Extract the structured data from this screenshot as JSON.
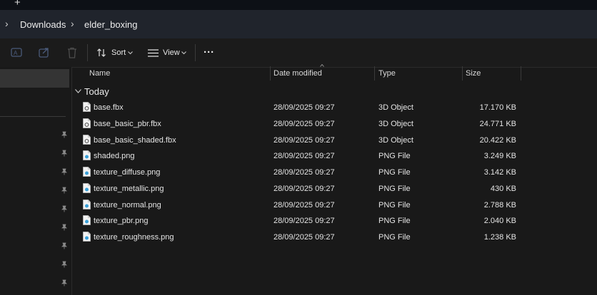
{
  "tabstrip": {
    "new_tab_icon": "plus-icon",
    "new_tab_glyph": "+"
  },
  "breadcrumb": {
    "separator": "›",
    "items": [
      "Downloads",
      "elder_boxing"
    ]
  },
  "toolbar": {
    "rename_icon": "rename-icon",
    "share_icon": "share-icon",
    "delete_icon": "trash-icon",
    "sort_label": "Sort",
    "view_label": "View",
    "more_glyph": "···"
  },
  "columns": {
    "name": "Name",
    "date": "Date modified",
    "type": "Type",
    "size": "Size"
  },
  "group": {
    "chevron": "⌄",
    "label": "Today"
  },
  "files": [
    {
      "name": "base.fbx",
      "date": "28/09/2025 09:27",
      "type": "3D Object",
      "size": "17.170 KB",
      "kind": "fbx"
    },
    {
      "name": "base_basic_pbr.fbx",
      "date": "28/09/2025 09:27",
      "type": "3D Object",
      "size": "24.771 KB",
      "kind": "fbx"
    },
    {
      "name": "base_basic_shaded.fbx",
      "date": "28/09/2025 09:27",
      "type": "3D Object",
      "size": "20.422 KB",
      "kind": "fbx"
    },
    {
      "name": "shaded.png",
      "date": "28/09/2025 09:27",
      "type": "PNG File",
      "size": "3.249 KB",
      "kind": "png"
    },
    {
      "name": "texture_diffuse.png",
      "date": "28/09/2025 09:27",
      "type": "PNG File",
      "size": "3.142 KB",
      "kind": "png"
    },
    {
      "name": "texture_metallic.png",
      "date": "28/09/2025 09:27",
      "type": "PNG File",
      "size": "430 KB",
      "kind": "png"
    },
    {
      "name": "texture_normal.png",
      "date": "28/09/2025 09:27",
      "type": "PNG File",
      "size": "2.788 KB",
      "kind": "png"
    },
    {
      "name": "texture_pbr.png",
      "date": "28/09/2025 09:27",
      "type": "PNG File",
      "size": "2.040 KB",
      "kind": "png"
    },
    {
      "name": "texture_roughness.png",
      "date": "28/09/2025 09:27",
      "type": "PNG File",
      "size": "1.238 KB",
      "kind": "png"
    }
  ],
  "colors": {
    "background": "#191919",
    "addressbar": "#20242c",
    "accent_png_icon": "#3aa0d8"
  }
}
